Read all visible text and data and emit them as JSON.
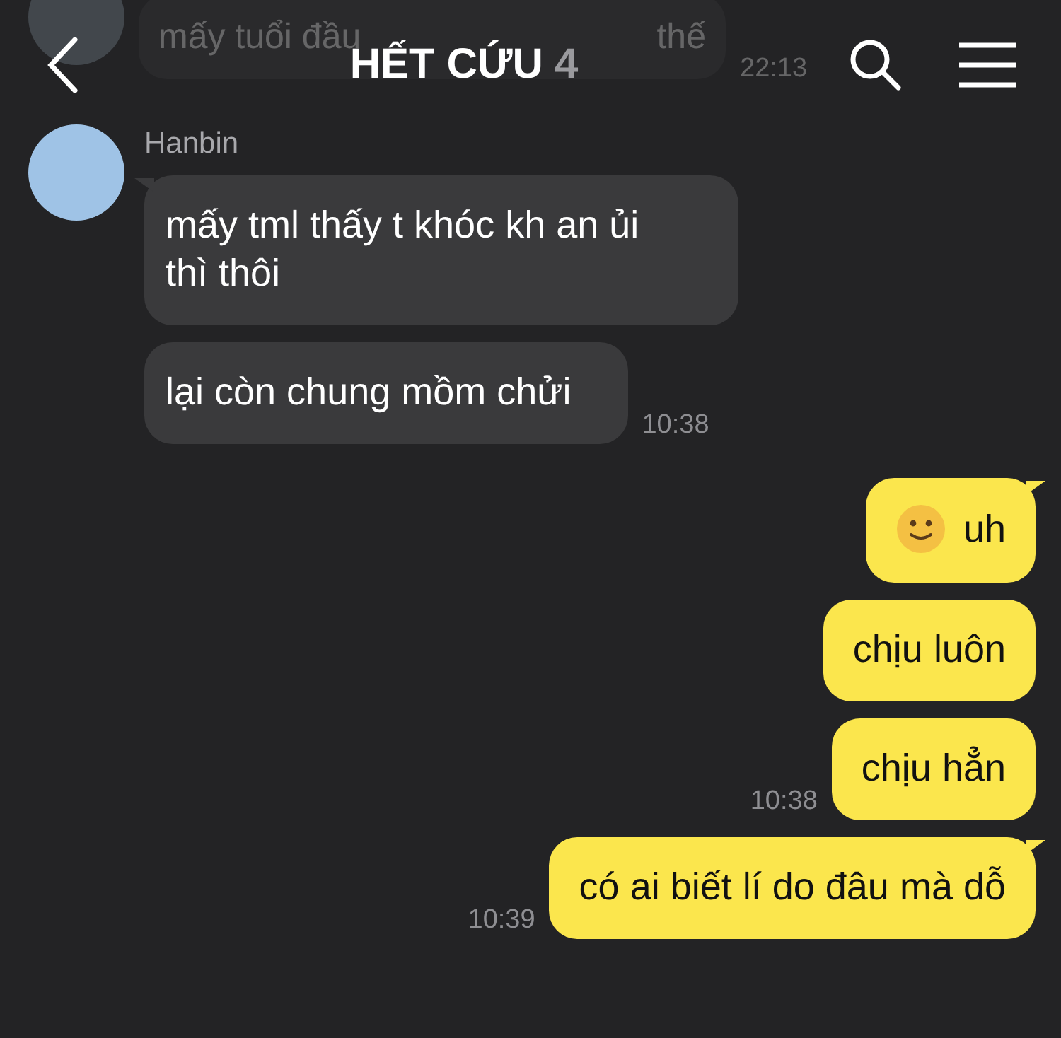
{
  "header": {
    "title": "HẾT CỨU",
    "member_count": "4"
  },
  "background_message": {
    "text_start": "mấy tuổi đầu",
    "text_end": "thế",
    "time": "22:13"
  },
  "messages": [
    {
      "kind": "incoming",
      "sender": "Hanbin",
      "text": "mấy tml thấy t khóc kh an ủi thì thôi",
      "tail": true
    },
    {
      "kind": "incoming",
      "text": "lại còn chung mồm chửi",
      "time": "10:38",
      "tail": false
    },
    {
      "kind": "outgoing",
      "text": "uh",
      "emoji": true,
      "tail": true
    },
    {
      "kind": "outgoing",
      "text": "chịu luôn",
      "tail": false
    },
    {
      "kind": "outgoing",
      "text": "chịu hẳn",
      "time": "10:38",
      "tail": false
    },
    {
      "kind": "outgoing",
      "text": "có ai biết lí do đâu mà dỗ",
      "time": "10:39",
      "tail": true
    }
  ]
}
